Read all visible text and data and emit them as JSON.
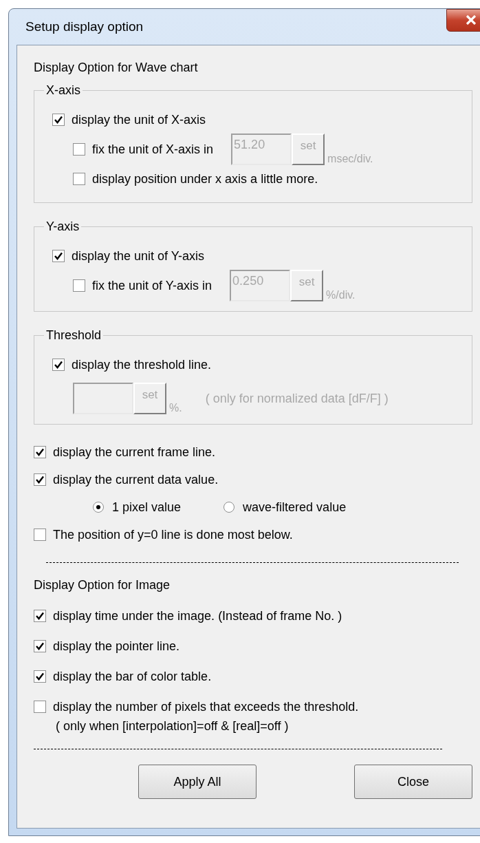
{
  "window": {
    "title": "Setup display option"
  },
  "wave_heading": "Display Option for Wave chart",
  "groups": [
    {
      "legend": "X-axis",
      "options": [
        {
          "kind": "checkbox",
          "label": "display the unit of X-axis",
          "checked": true,
          "children": [
            {
              "kind": "checkbox",
              "label": "fix the unit of X-axis in",
              "checked": false,
              "field": {
                "value": "51.20",
                "button": "set",
                "unit": "msec/div.",
                "disabled": true
              }
            },
            {
              "kind": "checkbox",
              "label": "display position under x axis a little more.",
              "checked": false
            }
          ]
        }
      ]
    },
    {
      "legend": "Y-axis",
      "options": [
        {
          "kind": "checkbox",
          "label": "display the unit of Y-axis",
          "checked": true,
          "children": [
            {
              "kind": "checkbox",
              "label": "fix the unit of Y-axis in",
              "checked": false,
              "field": {
                "value": "0.250",
                "button": "set",
                "unit": "%/div.",
                "disabled": true
              }
            }
          ]
        }
      ]
    },
    {
      "legend": "Threshold",
      "options": [
        {
          "kind": "checkbox",
          "label": "display the threshold line.",
          "checked": true,
          "children": [
            {
              "kind": "field",
              "field": {
                "button": "set",
                "unit": "%.",
                "note": "( only for normalized data [dF/F] )",
                "disabled": true
              }
            }
          ]
        }
      ]
    }
  ],
  "wave_options": [
    {
      "kind": "checkbox",
      "label": "display the current frame line.",
      "checked": true
    },
    {
      "kind": "checkbox",
      "label": "display the current data value.",
      "checked": true,
      "children": [
        {
          "kind": "radios",
          "options": [
            {
              "label": "1 pixel value",
              "selected": true
            },
            {
              "label": "wave-filtered value",
              "selected": false
            }
          ]
        }
      ]
    },
    {
      "kind": "checkbox",
      "label": "The position of y=0 line is done most below.",
      "checked": false
    }
  ],
  "image_heading": "Display Option for Image",
  "image_options": [
    {
      "kind": "checkbox",
      "label": "display time under the image. (Instead of frame No. )",
      "checked": true
    },
    {
      "kind": "checkbox",
      "label": "display the pointer line.",
      "checked": true
    },
    {
      "kind": "checkbox",
      "label": "display the bar of color table.",
      "checked": true
    },
    {
      "kind": "checkbox",
      "label": "display the number of pixels that exceeds the threshold.",
      "checked": false,
      "note": "( only when [interpolation]=off & [real]=off )"
    }
  ],
  "buttons": [
    "Apply All",
    "Close"
  ]
}
